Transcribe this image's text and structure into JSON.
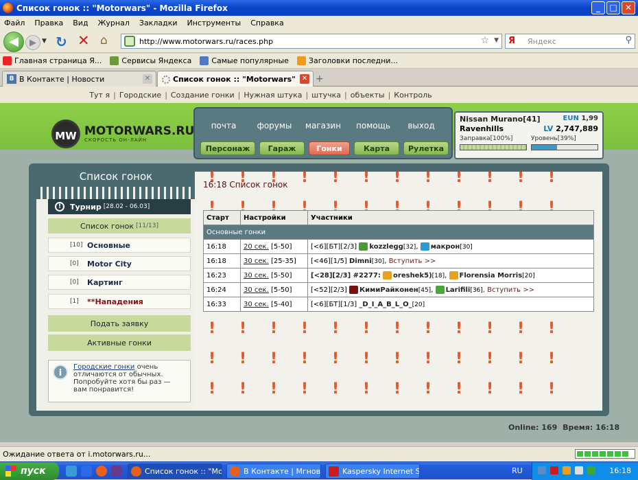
{
  "window": {
    "title": "Список гонок :: \"Motorwars\" - Mozilla Firefox",
    "min": "_",
    "max": "□",
    "close": "✕"
  },
  "menu": [
    "Файл",
    "Правка",
    "Вид",
    "Журнал",
    "Закладки",
    "Инструменты",
    "Справка"
  ],
  "nav": {
    "back": "◀",
    "forward": "▶",
    "dropdown": "▼",
    "reload": "↻",
    "stop": "✕",
    "home": "⌂"
  },
  "url": "http://www.motorwars.ru/races.php",
  "search": {
    "placeholder": "Яндекс",
    "engine_logo": "Я"
  },
  "bookmarks": [
    "Главная страница Я...",
    "Сервисы Яндекса",
    "Самые популярные",
    "Заголовки последни..."
  ],
  "tabs": [
    {
      "label": "В Контакте | Новости",
      "close": "✕"
    },
    {
      "label": "Список гонок :: \"Motorwars\"",
      "close": "✕"
    }
  ],
  "newtab": "+",
  "site": {
    "toplinks": [
      "Тут я",
      "Городские",
      "Создание гонки",
      "Нужная штука",
      "штучка",
      "объекты",
      "Контроль"
    ],
    "logo": {
      "mark": "MW",
      "name": "MOTORWARS.RU",
      "tagline": "СКОРОСТЬ ОН-ЛАЙН"
    },
    "menu_top": [
      "почта",
      "форумы",
      "магазин",
      "помощь",
      "выход"
    ],
    "menu_buttons": [
      "Персонаж",
      "Гараж",
      "Гонки",
      "Карта",
      "Рулетка"
    ],
    "player": {
      "car": "Nissan Murano[41]",
      "city": "Ravenhills",
      "eun_label": "EUN",
      "eun": "1,99",
      "lv_label": "LV",
      "lv": "2,747,889",
      "fuel_label": "Заправка[100%]",
      "fuel": 100,
      "level_label": "Уровень[39%]",
      "level": 39
    },
    "sidebar": {
      "title": "Список гонок",
      "tournament": "Турнир",
      "tournament_dates": "[28.02 - 06.03]",
      "city_races": "Список гонок",
      "city_races_count": "[11/13]",
      "items": [
        {
          "count": "[10]",
          "label": "Основные"
        },
        {
          "count": "[0]",
          "label": "Motor City"
        },
        {
          "count": "[0]",
          "label": "Картинг"
        },
        {
          "count": "[1]",
          "label": "**Нападения"
        }
      ],
      "apply": "Подать заявку",
      "active": "Активные гонки",
      "note_link": "Городские гонки",
      "note_text": "очень отличаются от обычных. Попробуйте хотя бы раз — вам понравится!"
    },
    "content": {
      "title": "16:18 Список гонок",
      "columns": [
        "Старт",
        "Настройки",
        "Участники"
      ],
      "group": "Основные гонки",
      "rows": [
        {
          "start": "16:18",
          "time": "20 сек.",
          "range": "[5-50]",
          "prefix": "[<6][БТ][2/3]",
          "p1": "kozzlegg",
          "p1lv": "[32]",
          "sep": ",",
          "p2": "макрон",
          "p2lv": "[30]",
          "join": ""
        },
        {
          "start": "16:18",
          "time": "30 сек.",
          "range": "[25-35]",
          "prefix": "[<46][1/5]",
          "p1": "Dimni",
          "p1lv": "[30]",
          "sep": ",",
          "p2": "",
          "p2lv": "",
          "join": "Вступить >>"
        },
        {
          "start": "16:23",
          "time": "30 сек.",
          "range": "[5-50]",
          "prefix": "[<28][2/3] #2277:",
          "p1": "oreshek5)",
          "p1lv": "[18]",
          "sep": ",",
          "p2": "Florensia Morris",
          "p2lv": "[20]",
          "join": ""
        },
        {
          "start": "16:24",
          "time": "30 сек.",
          "range": "[5-50]",
          "prefix": "[<52][2/3]",
          "p1": "КимиРайконен",
          "p1lv": "[45]",
          "sep": ",",
          "p2": "Larifili",
          "p2lv": "[36]",
          "join": ", Вступить >>"
        },
        {
          "start": "16:33",
          "time": "30 сек.",
          "range": "[5-40]",
          "prefix": "[<6][БТ][1/3]",
          "p1": "_D_I_A_B_L_O_",
          "p1lv": "[20]",
          "sep": "",
          "p2": "",
          "p2lv": "",
          "join": ""
        }
      ]
    },
    "online_label": "Online:",
    "online": "169",
    "time_label": "Время:",
    "time": "16:18"
  },
  "status": "Ожидание ответа от i.motorwars.ru...",
  "taskbar": {
    "start": "пуск",
    "tasks": [
      "Список гонок :: \"Mot...",
      "В Контакте | Мгнов...",
      "Kaspersky Internet S..."
    ],
    "lang": "RU",
    "clock": "16:18"
  }
}
